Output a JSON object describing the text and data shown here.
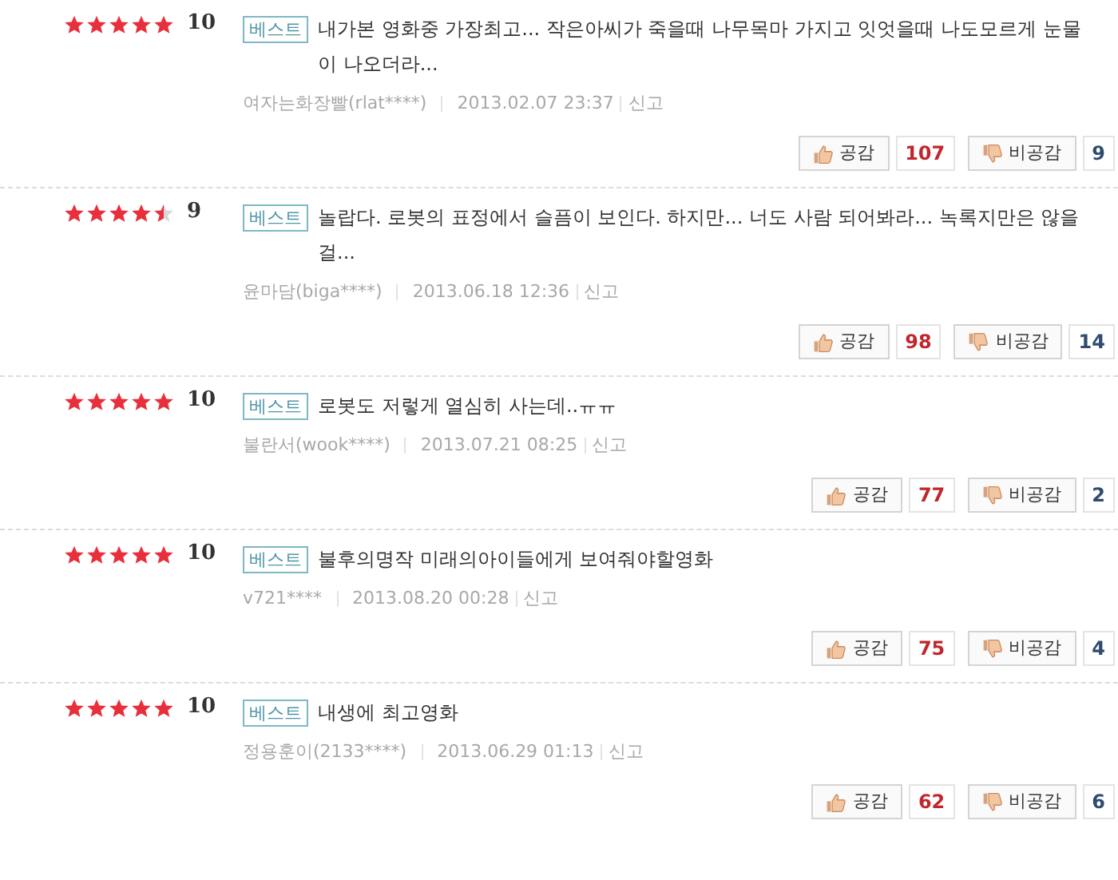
{
  "reviews": [
    {
      "stars": 5,
      "score": "10",
      "badge": "베스트",
      "text": "내가본 영화중 가장최고... 작은아씨가 죽을때 나무목마 가지고 잇엇을때 나도모르게 눈물이 나오더라...",
      "author": "여자는화장빨(rlat****)",
      "date": "2013.02.07 23:37",
      "report": "신고",
      "like_label": "공감",
      "likes": "107",
      "dislike_label": "비공감",
      "dislikes": "9"
    },
    {
      "stars": 4.5,
      "score": "9",
      "badge": "베스트",
      "text": "놀랍다. 로봇의 표정에서 슬픔이 보인다. 하지만... 너도 사람 되어봐라... 녹록지만은 않을걸...",
      "author": "윤마담(biga****)",
      "date": "2013.06.18 12:36",
      "report": "신고",
      "like_label": "공감",
      "likes": "98",
      "dislike_label": "비공감",
      "dislikes": "14"
    },
    {
      "stars": 5,
      "score": "10",
      "badge": "베스트",
      "text": "로봇도 저렇게 열심히 사는데..ㅠㅠ",
      "author": "불란서(wook****)",
      "date": "2013.07.21 08:25",
      "report": "신고",
      "like_label": "공감",
      "likes": "77",
      "dislike_label": "비공감",
      "dislikes": "2"
    },
    {
      "stars": 5,
      "score": "10",
      "badge": "베스트",
      "text": "불후의명작 미래의아이들에게 보여줘야할영화",
      "author": "v721****",
      "date": "2013.08.20 00:28",
      "report": "신고",
      "like_label": "공감",
      "likes": "75",
      "dislike_label": "비공감",
      "dislikes": "4"
    },
    {
      "stars": 5,
      "score": "10",
      "badge": "베스트",
      "text": "내생에 최고영화",
      "author": "정용훈이(2133****)",
      "date": "2013.06.29 01:13",
      "report": "신고",
      "like_label": "공감",
      "likes": "62",
      "dislike_label": "비공감",
      "dislikes": "6"
    }
  ]
}
